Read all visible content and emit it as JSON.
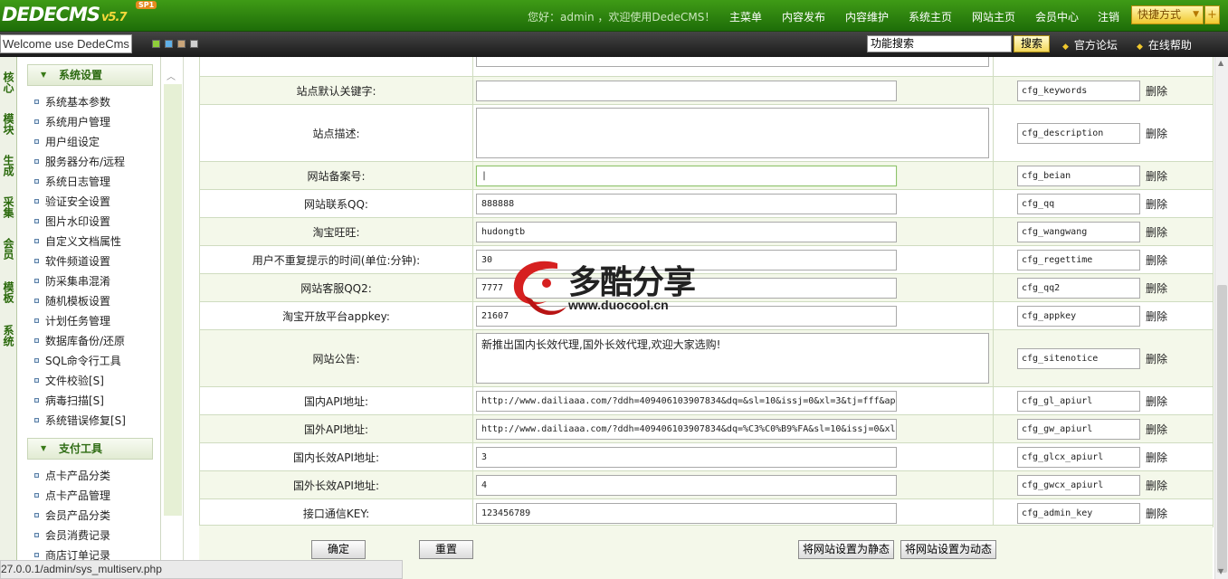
{
  "header": {
    "logo": "DEDECMS",
    "version": "v5.7",
    "edition": "SP1",
    "welcome": "您好：admin ，欢迎使用DedeCMS！",
    "nav": [
      "主菜单",
      "内容发布",
      "内容维护",
      "系统主页",
      "网站主页",
      "会员中心",
      "注销"
    ],
    "quick_label": "快捷方式",
    "quick_plus": "+"
  },
  "toolbar": {
    "welcome_text": "Welcome use DedeCms",
    "search_value": "功能搜索",
    "search_button": "搜索",
    "links": [
      "官方论坛",
      "在线帮助"
    ]
  },
  "vtabs": [
    "核心",
    "模块",
    "生成",
    "采集",
    "会员",
    "模板",
    "系统"
  ],
  "menu": {
    "section1": {
      "title": "系统设置",
      "items": [
        "系统基本参数",
        "系统用户管理",
        "用户组设定",
        "服务器分布/远程",
        "系统日志管理",
        "验证安全设置",
        "图片水印设置",
        "自定义文档属性",
        "软件频道设置",
        "防采集串混淆",
        "随机模板设置",
        "计划任务管理",
        "数据库备份/还原",
        "SQL命令行工具",
        "文件校验[S]",
        "病毒扫描[S]",
        "系统错误修复[S]"
      ]
    },
    "section2": {
      "title": "支付工具",
      "items": [
        "点卡产品分类",
        "点卡产品管理",
        "会员产品分类",
        "会员消费记录",
        "商店订单记录"
      ]
    }
  },
  "config_rows": [
    {
      "label": "",
      "value": "",
      "var": "",
      "type": "textarea_partial"
    },
    {
      "label": "站点默认关键字:",
      "value": "",
      "var": "cfg_keywords",
      "type": "input"
    },
    {
      "label": "站点描述:",
      "value": "",
      "var": "cfg_description",
      "type": "textarea"
    },
    {
      "label": "网站备案号:",
      "value": "|",
      "var": "cfg_beian",
      "type": "input_focus"
    },
    {
      "label": "网站联系QQ:",
      "value": "888888",
      "var": "cfg_qq",
      "type": "input"
    },
    {
      "label": "淘宝旺旺:",
      "value": "hudongtb",
      "var": "cfg_wangwang",
      "type": "input"
    },
    {
      "label": "用户不重复提示的时间(单位:分钟):",
      "value": "30",
      "var": "cfg_regettime",
      "type": "input"
    },
    {
      "label": "网站客服QQ2:",
      "value": "7777",
      "var": "cfg_qq2",
      "type": "input"
    },
    {
      "label": "淘宝开放平台appkey:",
      "value": "21607",
      "var": "cfg_appkey",
      "type": "input"
    },
    {
      "label": "网站公告:",
      "value": "新推出国内长效代理,国外长效代理,欢迎大家选购!",
      "var": "cfg_sitenotice",
      "type": "textarea"
    },
    {
      "label": "国内API地址:",
      "value": "http://www.dailiaaa.com/?ddh=409406103907834&dq=&sl=10&issj=0&xl=3&tj=fff&ap",
      "var": "cfg_gl_apiurl",
      "type": "input"
    },
    {
      "label": "国外API地址:",
      "value": "http://www.dailiaaa.com/?ddh=409406103907834&dq=%C3%C0%B9%FA&sl=10&issj=0&xl",
      "var": "cfg_gw_apiurl",
      "type": "input"
    },
    {
      "label": "国内长效API地址:",
      "value": "3",
      "var": "cfg_glcx_apiurl",
      "type": "input"
    },
    {
      "label": "国外长效API地址:",
      "value": "4",
      "var": "cfg_gwcx_apiurl",
      "type": "input"
    },
    {
      "label": "接口通信KEY:",
      "value": "123456789",
      "var": "cfg_admin_key",
      "type": "input"
    }
  ],
  "delete_label": "删除",
  "buttons": {
    "confirm": "确定",
    "reset": "重置",
    "set_static": "将网站设置为静态",
    "set_dynamic": "将网站设置为动态"
  },
  "watermark": {
    "title": "多酷分享",
    "url": "www.duocool.cn"
  },
  "status_url": "27.0.0.1/admin/sys_multiserv.php"
}
